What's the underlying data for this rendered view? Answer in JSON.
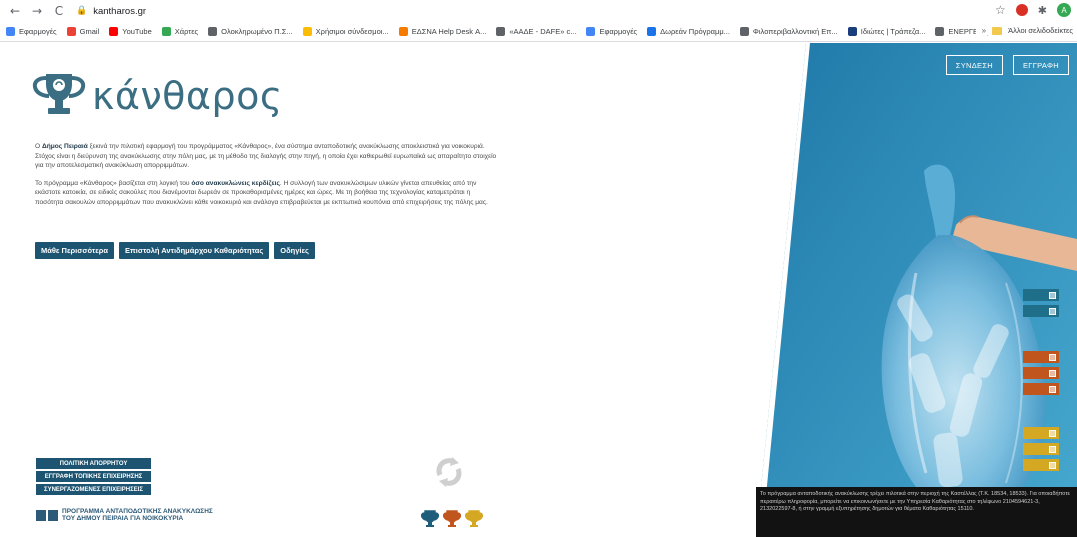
{
  "browser": {
    "url": "kantharos.gr",
    "profile_initial": "A",
    "bookmarks": [
      {
        "label": "Εφαρμογές",
        "color": "#4285f4"
      },
      {
        "label": "Gmail",
        "color": "#ea4335"
      },
      {
        "label": "YouTube",
        "color": "#ff0000"
      },
      {
        "label": "Χάρτες",
        "color": "#34a853"
      },
      {
        "label": "Ολοκληρωμένο Π.Σ...",
        "color": "#5f6368"
      },
      {
        "label": "Χρήσιμοι σύνδεσμοι...",
        "color": "#fbbc04"
      },
      {
        "label": "ΕΔΣΝΑ Help Desk Α...",
        "color": "#f57c00"
      },
      {
        "label": "«ΑΑΔΕ - DAFE» c...",
        "color": "#5f6368"
      },
      {
        "label": "Εφαρμογές",
        "color": "#4285f4"
      },
      {
        "label": "Δωρεάν Πρόγραμμ...",
        "color": "#1a73e8"
      },
      {
        "label": "Φιλοπεριβαλλοντική Επ...",
        "color": "#5f6368"
      },
      {
        "label": "Ιδιώτες | Τράπεζα...",
        "color": "#1a3d7c"
      },
      {
        "label": "ΕΝΕΡΓΕΙΑ | Green A...",
        "color": "#5f6368"
      }
    ],
    "more": "»",
    "other_bookmarks": "Άλλοι σελιδοδείκτες"
  },
  "site": {
    "logo_text": "κάνθαρος",
    "intro_p1_pre": "Ο ",
    "intro_p1_bold": "Δήμος Πειραιά",
    "intro_p1_post": " ξεκινά την πιλοτική εφαρμογή του προγράμματος «Κάνθαρος», ένα σύστημα ανταποδοτικής ανακύκλωσης αποκλειστικά για νοικοκυριά. Στόχος είναι η διεύρυνση της ανακύκλωσης στην πόλη μας, με τη μέθοδο της διαλογής στην πηγή, η οποία έχει καθιερωθεί ευρωπαϊκά ως απαραίτητο στοιχείο για την αποτελεσματική ανακύκλωση απορριμμάτων.",
    "intro_p2_pre": "Το πρόγραμμα «Κάνθαρος» βασίζεται στη λογική του ",
    "intro_p2_bold": "όσο ανακυκλώνεις κερδίζεις",
    "intro_p2_post": ". Η συλλογή των ανακυκλώσιμων υλικών γίνεται απευθείας από την εκάστοτε κατοικία, σε ειδικές σακούλες που διανέμονται δωρεάν σε προκαθορισμένες ημέρες και ώρες. Με τη βοήθεια της τεχνολογίας καταμετράται η ποσότητα σακουλών απορριμμάτων που ανακυκλώνει κάθε νοικοκυριό και ανάλογα επιβραβεύεται με εκπτωτικά κουπόνια από επιχειρήσεις της πόλης μας.",
    "buttons": {
      "learn_more": "Μάθε Περισσότερα",
      "letter": "Επιστολή Αντιδημάρχου Καθαριότητας",
      "instructions": "Οδηγίες"
    },
    "footer_links": {
      "privacy": "ΠΟΛΙΤΙΚΗ ΑΠΟΡΡΗΤΟΥ",
      "local_business": "ΕΓΓΡΑΦΗ ΤΟΠΙΚΗΣ ΕΠΙΧΕΙΡΗΣΗΣ",
      "partners": "ΣΥΝΕΡΓΑΖΟΜΕΝΕΣ ΕΠΙΧΕΙΡΗΣΕΙΣ"
    },
    "program_line1": "ΠΡΟΓΡΑΜΜΑ ΑΝΤΑΠΟΔΟΤΙΚΗΣ ΑΝΑΚΥΚΛΩΣΗΣ",
    "program_line2": "ΤΟΥ ΔΗΜΟΥ ΠΕΙΡΑΙΑ ΓΙΑ ΝΟΙΚΟΚΥΡΙΑ",
    "auth": {
      "login": "ΣΥΝΔΕΣΗ",
      "register": "ΕΓΓΡΑΦΗ"
    },
    "disclaimer": "Το πρόγραμμα ανταποδοτικής ανακύκλωσης τρέχει πιλοτικά στην περιοχή της Καστέλλας (Τ.Κ. 18534, 18533). Για οποιαδήποτε περαιτέρω πληροφορία, μπορείτε να επικοινωνήσετε με την Υπηρεσία Καθαριότητας στο τηλέφωνο 2104594621-3, 2132022597-8, ή στην γραμμή εξυπηρέτησης δημοτών για θέματα Καθαριότητας 15110.",
    "colors": {
      "primary": "#1c5471",
      "logo": "#3b6e82",
      "tab_blue": "#1f6f8b",
      "tab_orange": "#c0561e",
      "tab_yellow": "#d4a823",
      "hero_bg": "#3fa1c6"
    }
  }
}
